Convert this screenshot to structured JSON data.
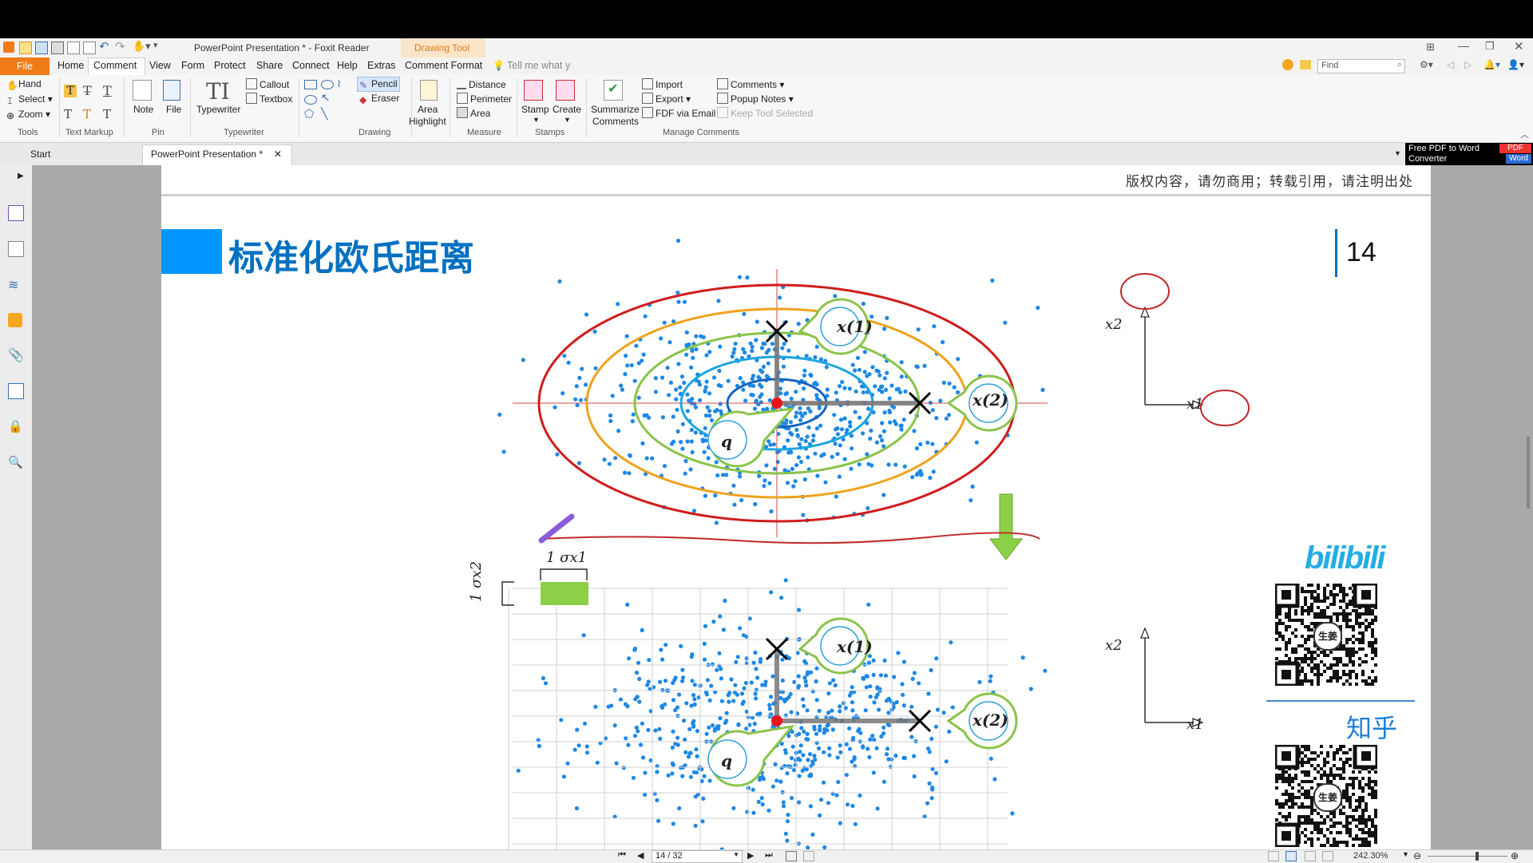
{
  "window": {
    "title": "PowerPoint Presentation * - Foxit Reader",
    "context_tab": "Drawing Tool"
  },
  "menu": {
    "items": [
      "File",
      "Home",
      "Comment",
      "View",
      "Form",
      "Protect",
      "Share",
      "Connect",
      "Help",
      "Extras",
      "Comment Format"
    ],
    "active": "Comment",
    "tell_me": "Tell me what y",
    "find_placeholder": "Find"
  },
  "ribbon": {
    "tools": {
      "hand": "Hand",
      "select": "Select",
      "zoom": "Zoom",
      "label": "Tools"
    },
    "text_markup": {
      "label": "Text Markup"
    },
    "pin": {
      "note": "Note",
      "file": "File",
      "label": "Pin"
    },
    "typewriter": {
      "typewriter": "Typewriter",
      "callout": "Callout",
      "textbox": "Textbox",
      "label": "Typewriter"
    },
    "drawing": {
      "pencil": "Pencil",
      "eraser": "Eraser",
      "label": "Drawing"
    },
    "area_highlight": {
      "line1": "Area",
      "line2": "Highlight"
    },
    "measure": {
      "distance": "Distance",
      "perimeter": "Perimeter",
      "area": "Area",
      "label": "Measure"
    },
    "stamps": {
      "stamp": "Stamp",
      "create": "Create",
      "label": "Stamps"
    },
    "summarize": {
      "line1": "Summarize",
      "line2": "Comments"
    },
    "manage": {
      "import": "Import",
      "export": "Export",
      "fdf": "FDF via Email",
      "comments": "Comments",
      "popup": "Popup Notes",
      "keep": "Keep Tool Selected",
      "label": "Manage Comments"
    }
  },
  "ad": {
    "line1": "Free PDF to Word",
    "line2": "Converter",
    "badge1": "PDF",
    "badge2": "Word"
  },
  "tabs": {
    "start": "Start",
    "doc": "PowerPoint Presentation *"
  },
  "slide": {
    "copyright": "版权内容，请勿商用；转载引用，请注明出处",
    "title": "标准化欧氏距离",
    "page_number": "14",
    "labels": {
      "x1": "x(1)",
      "x2": "x(2)",
      "q": "q",
      "axis_x1": "x1",
      "axis_x2": "x2",
      "sigma_x1": "1 σx1",
      "sigma_x2": "1 σx2"
    },
    "bilibili": "bilibili",
    "zhihu": "知乎",
    "qr_center": "生姜"
  },
  "status": {
    "page": "14 / 32",
    "zoom": "242.30%"
  },
  "colors": {
    "accent": "#f07b19",
    "title_blue": "#0070c0",
    "title_block": "#0096ff",
    "ellipse_red": "#d01c1c",
    "ellipse_orange": "#eea21d",
    "ellipse_green": "#8bc34a",
    "ellipse_blue": "#1da6e0",
    "point_blue": "#1e88e5"
  }
}
